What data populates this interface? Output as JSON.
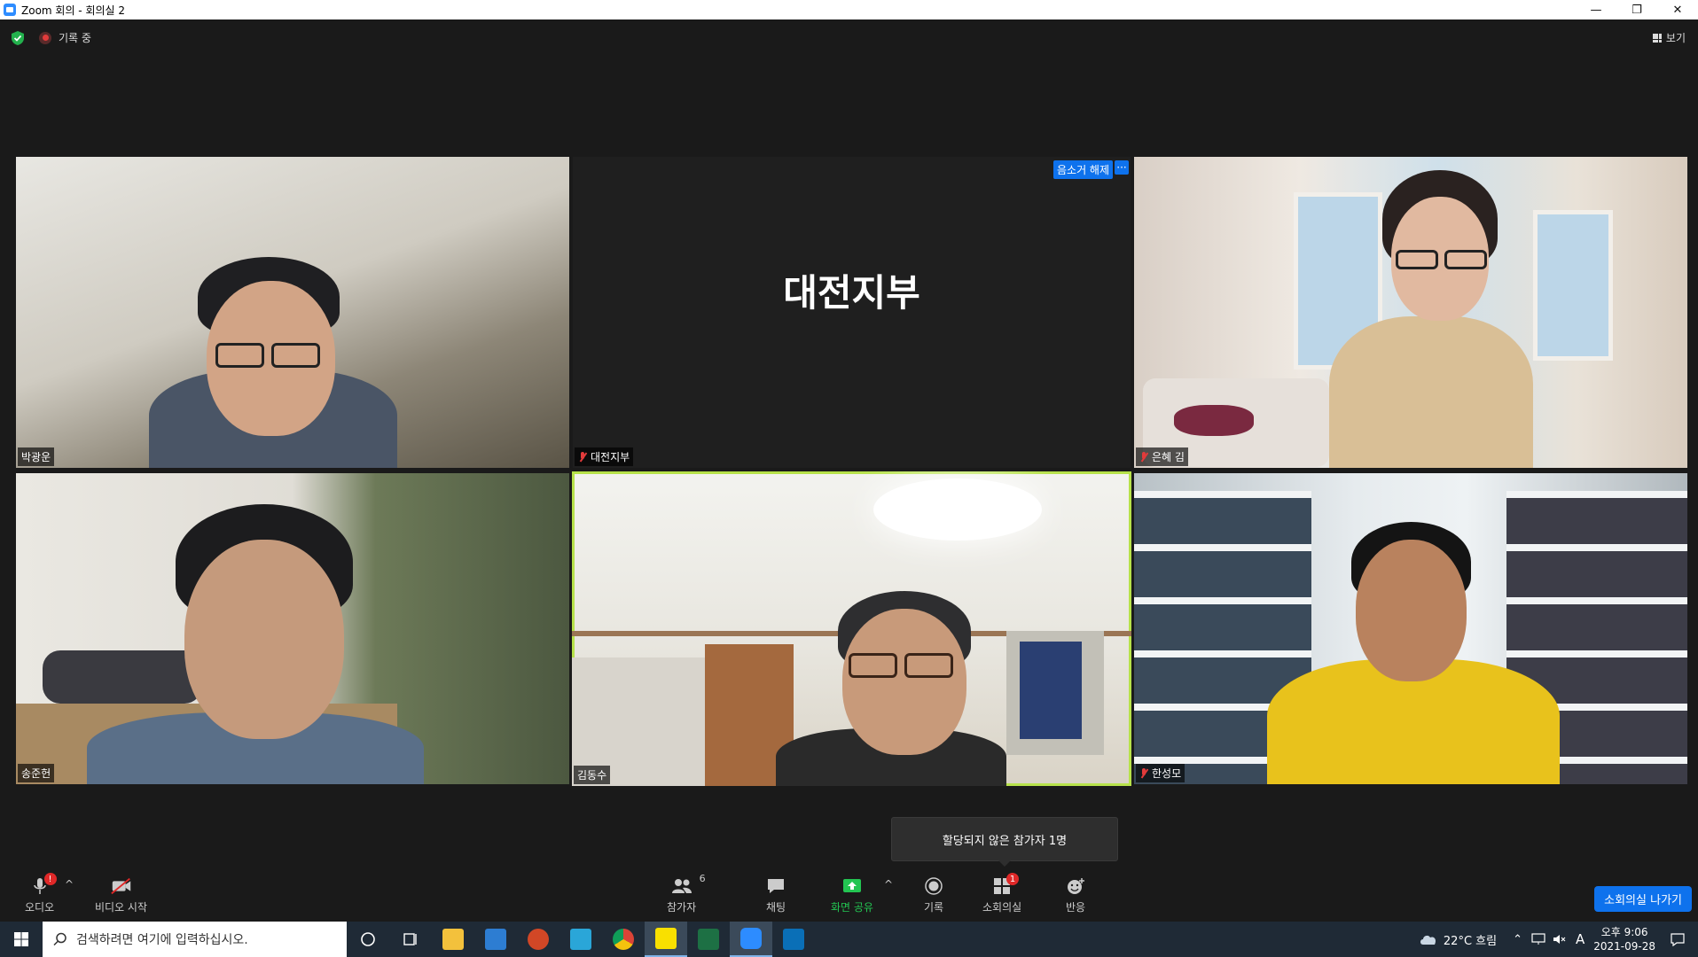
{
  "window": {
    "title": "Zoom 회의 - 회의실 2",
    "minimize": "—",
    "restore": "❐",
    "close": "✕"
  },
  "top": {
    "recording_label": "기록 중",
    "view_label": "보기"
  },
  "tiles": [
    {
      "name": "박광운",
      "muted": false
    },
    {
      "name": "대전지부",
      "muted": true,
      "center_text": "대전지부",
      "unmute_label": "음소거 해제",
      "more_label": "···"
    },
    {
      "name": "은혜 김",
      "muted": true
    },
    {
      "name": "송준헌",
      "muted": false
    },
    {
      "name": "김동수",
      "muted": false
    },
    {
      "name": "한성모",
      "muted": true
    }
  ],
  "tooltip": "할당되지 않은 참가자 1명",
  "toolbar": {
    "audio_label": "오디오",
    "video_label": "비디오 시작",
    "participants_label": "참가자",
    "participants_count": "6",
    "chat_label": "채팅",
    "share_label": "화면 공유",
    "record_label": "기록",
    "breakout_label": "소회의실",
    "breakout_badge": "1",
    "reactions_label": "반응",
    "leave_breakout_label": "소회의실 나가기",
    "caret": "^"
  },
  "taskbar": {
    "search_placeholder": "검색하려면 여기에 입력하십시오.",
    "weather": "22°C 흐림",
    "input_indicator": "A",
    "time": "오후 9:06",
    "date": "2021-09-28"
  }
}
